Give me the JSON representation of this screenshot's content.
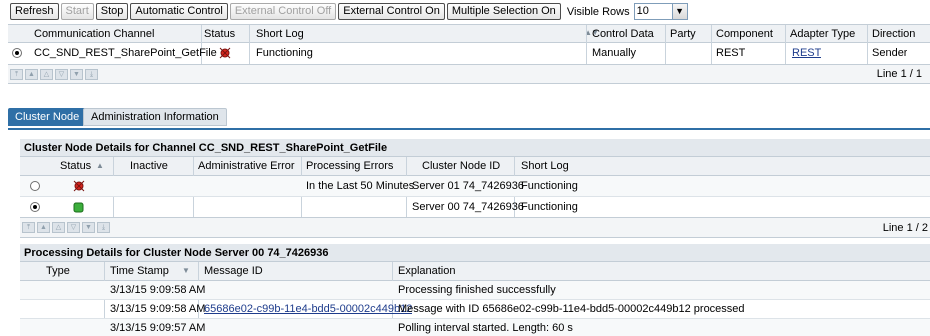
{
  "toolbar": {
    "buttons": [
      {
        "label": "Refresh",
        "enabled": true
      },
      {
        "label": "Start",
        "enabled": false
      },
      {
        "label": "Stop",
        "enabled": true
      },
      {
        "label": "Automatic Control",
        "enabled": true
      },
      {
        "label": "External Control Off",
        "enabled": false
      },
      {
        "label": "External Control On",
        "enabled": true
      },
      {
        "label": "Multiple Selection On",
        "enabled": true
      }
    ],
    "visible_rows_label": "Visible Rows",
    "visible_rows_value": "10"
  },
  "channel_table": {
    "headers": [
      "Communication Channel",
      "Status",
      "Short Log",
      "Control Data",
      "Party",
      "Component",
      "Adapter Type",
      "Direction"
    ],
    "row": {
      "channel": "CC_SND_REST_SharePoint_GetFile",
      "status_icon": "error-status-icon",
      "short_log": "Functioning",
      "control_data": "Manually",
      "party": "",
      "component": "REST",
      "adapter_type": "REST",
      "direction": "Sender"
    },
    "line_info": "Line 1 / 1"
  },
  "tabs": [
    "Cluster Node",
    "Administration Information"
  ],
  "cluster_section": {
    "title": "Cluster Node Details for Channel CC_SND_REST_SharePoint_GetFile",
    "headers": [
      "Status",
      "Inactive",
      "Administrative Error",
      "Processing Errors",
      "Cluster Node ID",
      "Short Log"
    ],
    "rows": [
      {
        "status_icon": "error-status-icon",
        "inactive": "",
        "admin_error": "",
        "processing_errors": "In the Last 50 Minutes",
        "node_id": "Server 01 74_7426936",
        "short_log": "Functioning",
        "selected": false
      },
      {
        "status_icon": "ok-status-icon",
        "inactive": "",
        "admin_error": "",
        "processing_errors": "",
        "node_id": "Server 00 74_7426936",
        "short_log": "Functioning",
        "selected": true
      }
    ],
    "line_info": "Line 1 / 2"
  },
  "processing_section": {
    "title": "Processing Details for Cluster Node Server 00 74_7426936",
    "headers": [
      "Type",
      "Time Stamp",
      "Message ID",
      "Explanation"
    ],
    "rows": [
      {
        "type": "",
        "timestamp": "3/13/15 9:09:58 AM",
        "message_id": "",
        "explanation": "Processing finished successfully"
      },
      {
        "type": "",
        "timestamp": "3/13/15 9:09:58 AM",
        "message_id": "65686e02-c99b-11e4-bdd5-00002c449b12",
        "explanation": "Message with ID 65686e02-c99b-11e4-bdd5-00002c449b12 processed"
      },
      {
        "type": "",
        "timestamp": "3/13/15 9:09:57 AM",
        "message_id": "",
        "explanation": "Polling interval started. Length: 60 s"
      }
    ]
  },
  "colors": {
    "accent": "#2f6fa6",
    "header_bg": "#eef1f4",
    "link": "#1e3c8c",
    "error": "#d8251d",
    "ok": "#3cae3c"
  }
}
